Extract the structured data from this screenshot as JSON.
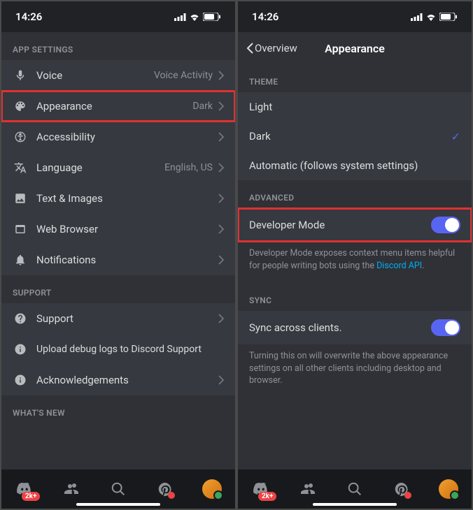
{
  "status": {
    "time": "14:26"
  },
  "left": {
    "appSettingsHeader": "APP SETTINGS",
    "supportHeader": "SUPPORT",
    "whatsNewHeader": "WHAT'S NEW",
    "items": {
      "voice": {
        "label": "Voice",
        "value": "Voice Activity"
      },
      "appearance": {
        "label": "Appearance",
        "value": "Dark"
      },
      "accessibility": {
        "label": "Accessibility"
      },
      "language": {
        "label": "Language",
        "value": "English, US"
      },
      "textImages": {
        "label": "Text & Images"
      },
      "webBrowser": {
        "label": "Web Browser"
      },
      "notifications": {
        "label": "Notifications"
      }
    },
    "support": {
      "support": {
        "label": "Support"
      },
      "upload": {
        "label": "Upload debug logs to Discord Support"
      },
      "ack": {
        "label": "Acknowledgements"
      }
    }
  },
  "right": {
    "back": "Overview",
    "title": "Appearance",
    "themeHeader": "THEME",
    "theme": {
      "light": "Light",
      "dark": "Dark",
      "automatic": "Automatic (follows system settings)"
    },
    "advancedHeader": "ADVANCED",
    "devMode": {
      "label": "Developer Mode",
      "desc": "Developer Mode exposes context menu items helpful for people writing bots using the ",
      "link": "Discord API"
    },
    "syncHeader": "SYNC",
    "sync": {
      "label": "Sync across clients.",
      "desc": "Turning this on will overwrite the above appearance settings on all other clients including desktop and browser."
    }
  },
  "tabs": {
    "badge": "2k+"
  }
}
